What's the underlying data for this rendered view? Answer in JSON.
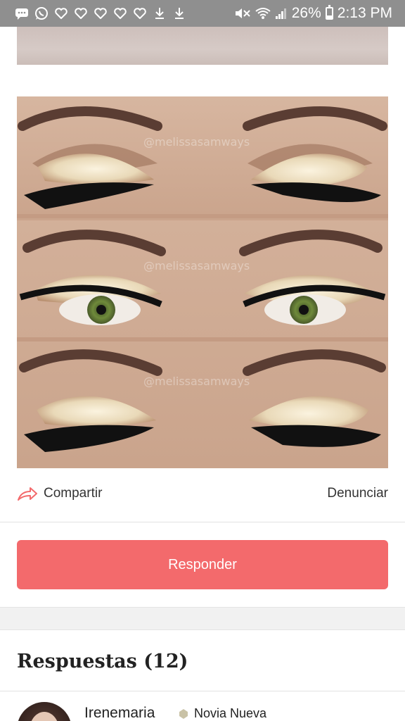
{
  "status_bar": {
    "left_icons": [
      "message-icon",
      "whatsapp-icon",
      "heart-icon",
      "heart-icon",
      "heart-icon",
      "heart-icon",
      "heart-icon",
      "download-icon",
      "download-icon"
    ],
    "battery_text": "26%",
    "battery_level": 0.26,
    "time": "2:13 PM"
  },
  "post": {
    "image_watermark": "@melissasamways",
    "share_label": "Compartir",
    "report_label": "Denunciar",
    "reply_button_label": "Responder"
  },
  "answers": {
    "title": "Respuestas (12)",
    "items": [
      {
        "user": "Irenemaria",
        "rank": "Novia Nueva"
      }
    ]
  },
  "colors": {
    "accent": "#f36a6c",
    "status_bar": "#8f8f8f"
  }
}
